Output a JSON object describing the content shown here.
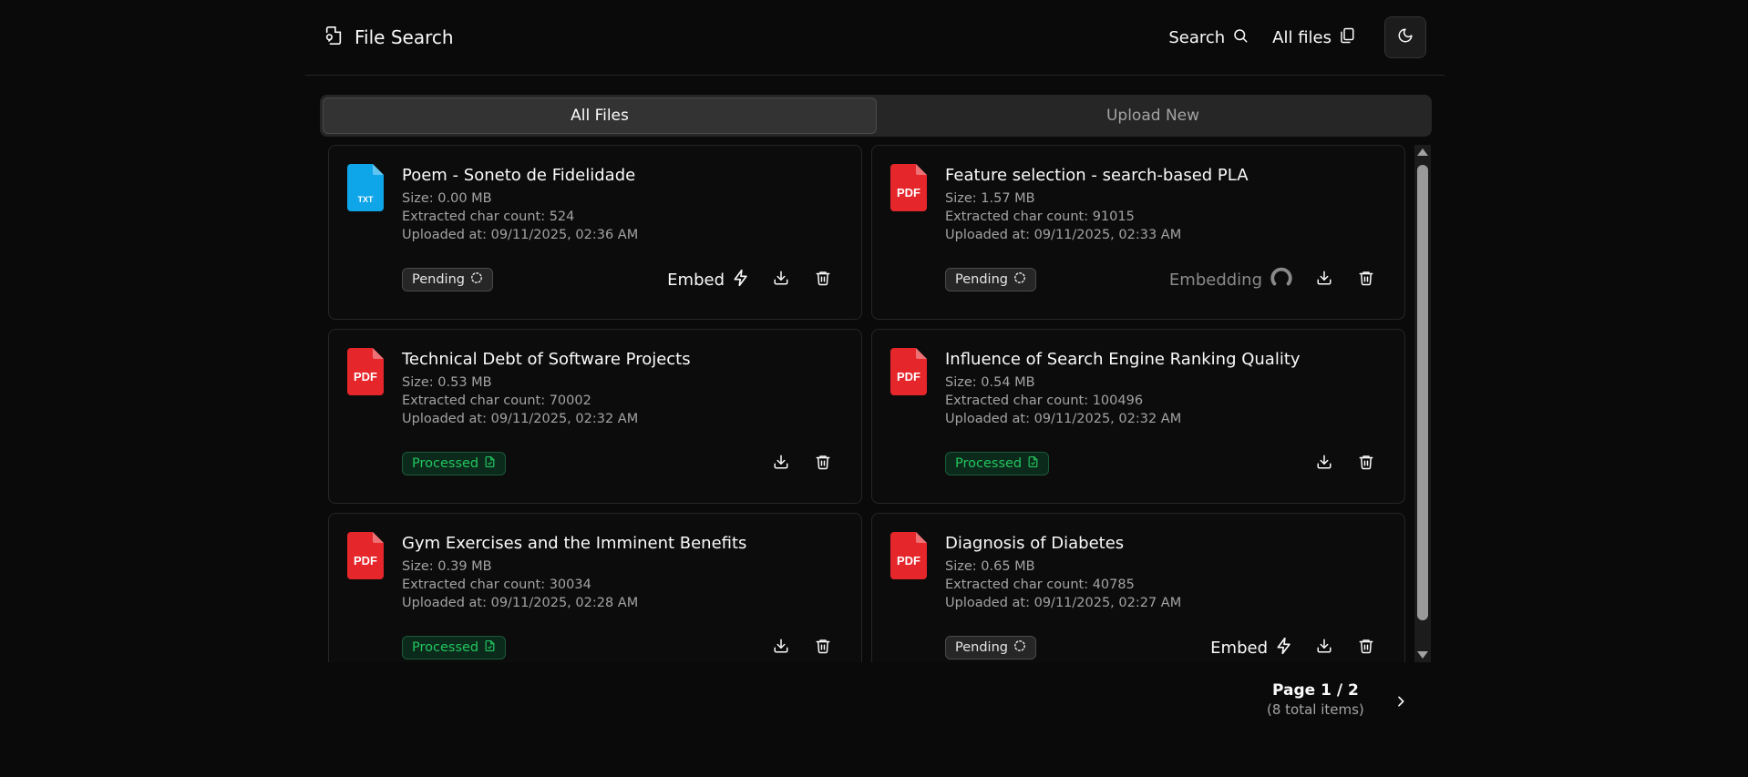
{
  "header": {
    "app_title": "File Search",
    "nav": {
      "search_label": "Search",
      "all_files_label": "All files"
    }
  },
  "tabs": [
    {
      "label": "All Files",
      "active": true
    },
    {
      "label": "Upload New",
      "active": false
    }
  ],
  "files": [
    {
      "title": "Poem - Soneto de Fidelidade",
      "type": "TXT",
      "size": "Size: 0.00 MB",
      "chars": "Extracted char count: 524",
      "uploaded": "Uploaded at: 09/11/2025, 02:36 AM",
      "status": "Pending",
      "action": "Embed"
    },
    {
      "title": "Feature selection - search-based PLA",
      "type": "PDF",
      "size": "Size: 1.57 MB",
      "chars": "Extracted char count: 91015",
      "uploaded": "Uploaded at: 09/11/2025, 02:33 AM",
      "status": "Pending",
      "action": "Embedding"
    },
    {
      "title": "Technical Debt of Software Projects",
      "type": "PDF",
      "size": "Size: 0.53 MB",
      "chars": "Extracted char count: 70002",
      "uploaded": "Uploaded at: 09/11/2025, 02:32 AM",
      "status": "Processed",
      "action": ""
    },
    {
      "title": "Influence of Search Engine Ranking Quality",
      "type": "PDF",
      "size": "Size: 0.54 MB",
      "chars": "Extracted char count: 100496",
      "uploaded": "Uploaded at: 09/11/2025, 02:32 AM",
      "status": "Processed",
      "action": ""
    },
    {
      "title": "Gym Exercises and the Imminent Benefits",
      "type": "PDF",
      "size": "Size: 0.39 MB",
      "chars": "Extracted char count: 30034",
      "uploaded": "Uploaded at: 09/11/2025, 02:28 AM",
      "status": "Processed",
      "action": ""
    },
    {
      "title": "Diagnosis of Diabetes",
      "type": "PDF",
      "size": "Size: 0.65 MB",
      "chars": "Extracted char count: 40785",
      "uploaded": "Uploaded at: 09/11/2025, 02:27 AM",
      "status": "Pending",
      "action": "Embed"
    }
  ],
  "pagination": {
    "page_label": "Page 1 / 2",
    "total_label": "(8 total items)"
  },
  "colors": {
    "pdf": "#e5262b",
    "txt": "#0ea5e9",
    "processed": "#22c55e",
    "background": "#0a0a0a"
  },
  "icons": [
    "file-search-icon",
    "search-icon",
    "copy-files-icon",
    "moon-icon",
    "txt-file-icon",
    "pdf-file-icon",
    "spinner-icon",
    "zap-icon",
    "download-icon",
    "trash-icon",
    "file-check-icon",
    "chevron-right-icon"
  ]
}
